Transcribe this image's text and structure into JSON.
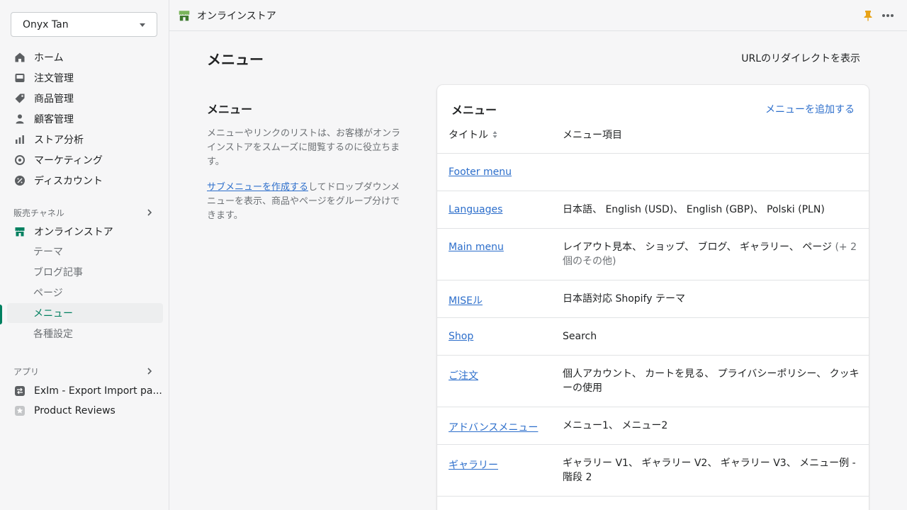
{
  "store": {
    "name": "Onyx Tan"
  },
  "sidebar": {
    "nav": [
      {
        "label": "ホーム",
        "icon": "home-icon"
      },
      {
        "label": "注文管理",
        "icon": "inbox-icon"
      },
      {
        "label": "商品管理",
        "icon": "tag-icon"
      },
      {
        "label": "顧客管理",
        "icon": "person-icon"
      },
      {
        "label": "ストア分析",
        "icon": "bar-chart-icon"
      },
      {
        "label": "マーケティング",
        "icon": "target-icon"
      },
      {
        "label": "ディスカウント",
        "icon": "discount-icon"
      }
    ],
    "sales_channels_title": "販売チャネル",
    "online_store_label": "オンラインストア",
    "online_store_sub": [
      "テーマ",
      "ブログ記事",
      "ページ",
      "メニュー",
      "各種設定"
    ],
    "apps_title": "アプリ",
    "apps": [
      {
        "label": "ExIm - Export Import pa...",
        "icon": "app-exim-icon"
      },
      {
        "label": "Product Reviews",
        "icon": "star-icon"
      }
    ]
  },
  "topbar": {
    "title": "オンラインストア"
  },
  "main": {
    "title": "メニュー",
    "redirect_link": "URLのリダイレクトを表示",
    "desc_title": "メニュー",
    "desc_text": "メニューやリンクのリストは、お客様がオンラインストアをスムーズに閲覧するのに役立ちます。",
    "desc_link": "サブメニューを作成する",
    "desc_text2": "してドロップダウンメニューを表示、商品やページをグループ分けできます。"
  },
  "card": {
    "title": "メニュー",
    "add_link": "メニューを追加する",
    "col_title": "タイトル",
    "col_items": "メニュー項目",
    "rows": [
      {
        "name": "Footer menu",
        "items": "",
        "more": ""
      },
      {
        "name": "Languages",
        "items": "日本語、 English (USD)、 English (GBP)、 Polski (PLN)",
        "more": ""
      },
      {
        "name": "Main menu",
        "items": "レイアウト見本、 ショップ、 ブログ、 ギャラリー、 ページ",
        "more": "(+ 2 個のその他)"
      },
      {
        "name": "MISEル",
        "items": "日本語対応 Shopify テーマ",
        "more": ""
      },
      {
        "name": "Shop",
        "items": "Search",
        "more": ""
      },
      {
        "name": "ご注文",
        "items": "個人アカウント、 カートを見る、 プライバシーポリシー、 クッキーの使用",
        "more": ""
      },
      {
        "name": "アドバンスメニュー",
        "items": "メニュー1、 メニュー2",
        "more": ""
      },
      {
        "name": "ギャラリー",
        "items": "ギャラリー V1、 ギャラリー V2、 ギャラリー V3、 メニュー例 - 階段 2",
        "more": ""
      }
    ]
  },
  "colors": {
    "accent": "#008060",
    "link": "#2c6ecb",
    "pin": "#e8a317"
  }
}
